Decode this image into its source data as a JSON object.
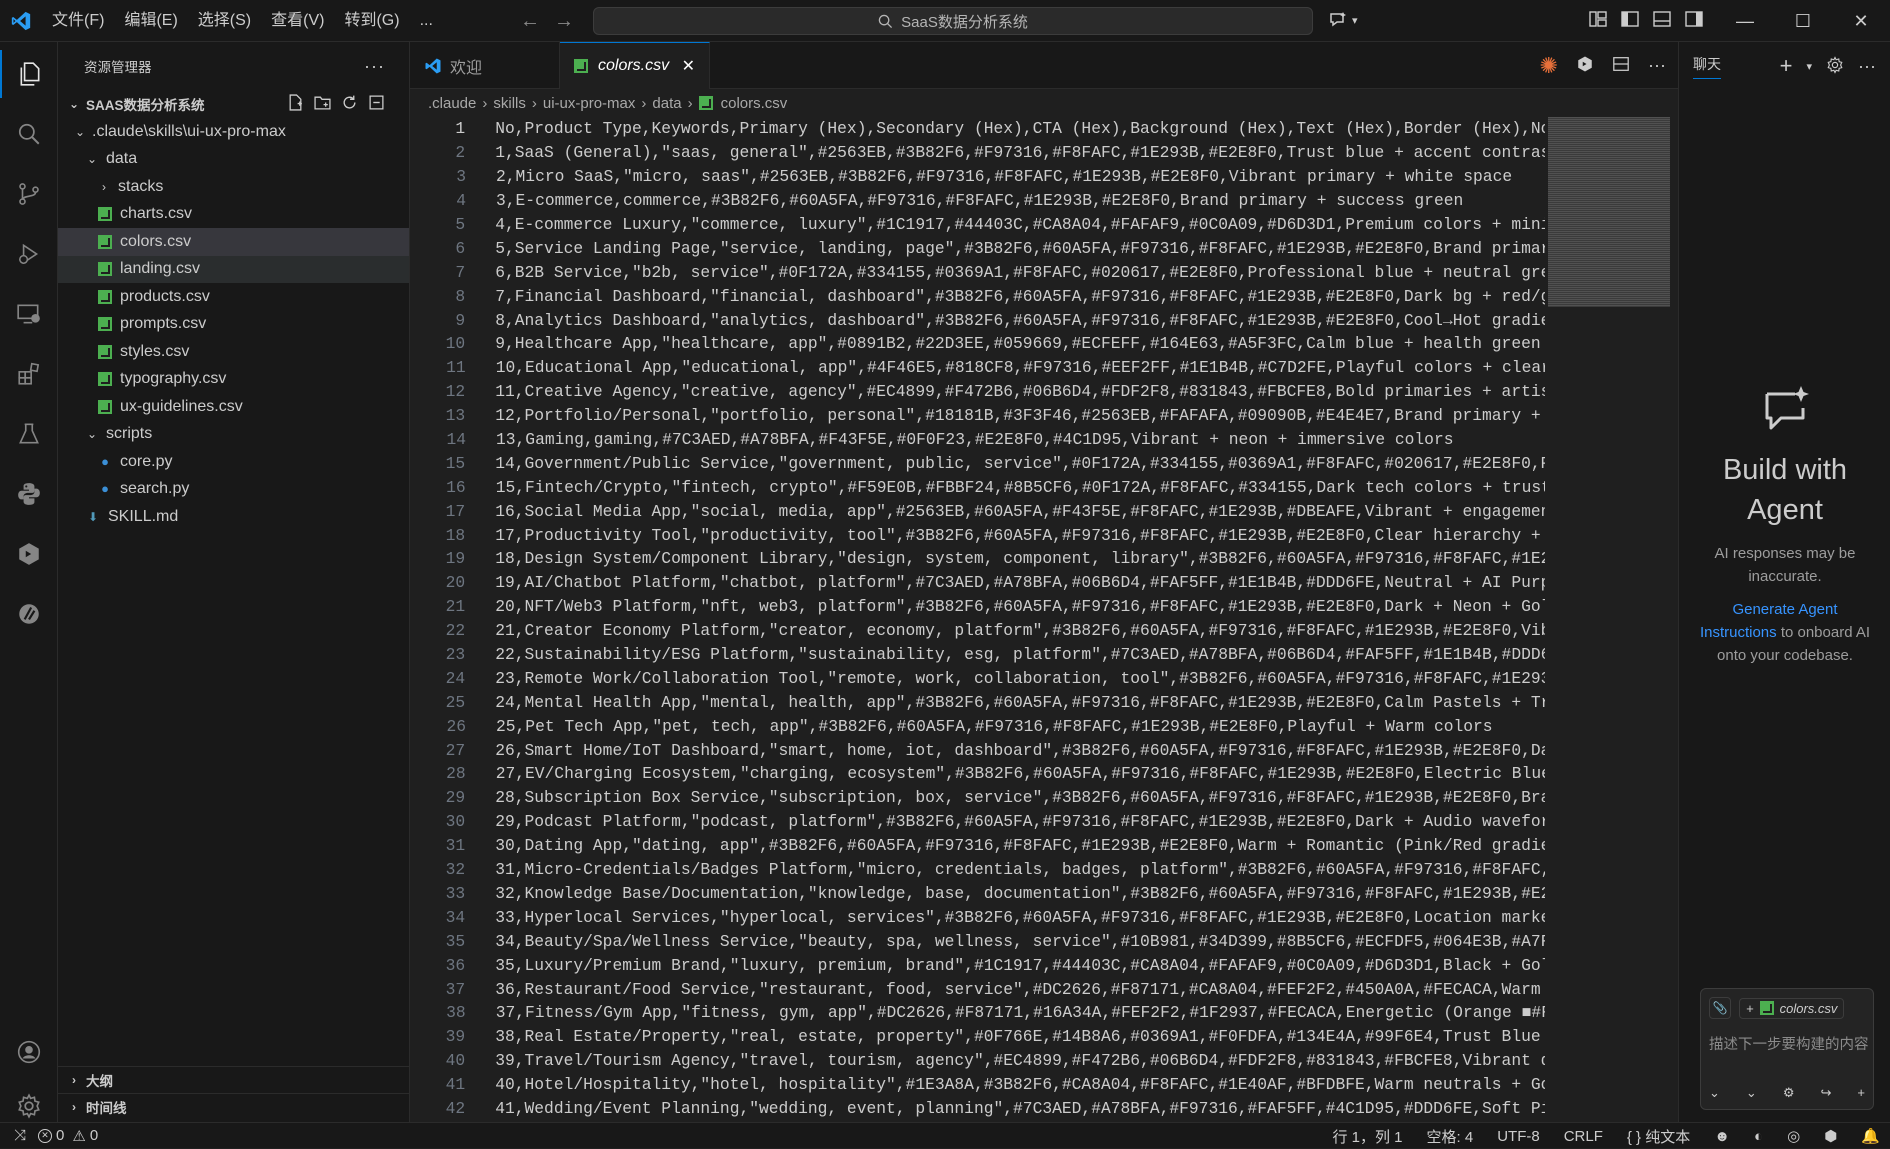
{
  "titlebar": {
    "menu": [
      "文件(F)",
      "编辑(E)",
      "选择(S)",
      "查看(V)",
      "转到(G)",
      "..."
    ],
    "search_text": "SaaS数据分析系统",
    "colors": {
      "accent": "#0078d4",
      "bg": "#181818",
      "editor_bg": "#1f1f1f"
    }
  },
  "activity_bar": {
    "items": [
      "explorer-icon",
      "search-icon",
      "source-control-icon",
      "run-debug-icon",
      "remote-explorer-icon",
      "extensions-icon",
      "testing-icon",
      "python-icon",
      "deploy-icon",
      "kiro-icon"
    ],
    "bottom": [
      "account-icon",
      "settings-gear-icon"
    ]
  },
  "sidebar": {
    "title": "资源管理器",
    "section": "SAAS数据分析系统",
    "tree": [
      {
        "label": ".claude\\skills\\ui-ux-pro-max",
        "type": "folder",
        "open": true,
        "indent": 1
      },
      {
        "label": "data",
        "type": "folder",
        "open": true,
        "indent": 2
      },
      {
        "label": "stacks",
        "type": "folder",
        "open": false,
        "indent": 3
      },
      {
        "label": "charts.csv",
        "type": "csv",
        "indent": 3
      },
      {
        "label": "colors.csv",
        "type": "csv",
        "indent": 3,
        "selected": true
      },
      {
        "label": "landing.csv",
        "type": "csv",
        "indent": 3,
        "hover": true
      },
      {
        "label": "products.csv",
        "type": "csv",
        "indent": 3
      },
      {
        "label": "prompts.csv",
        "type": "csv",
        "indent": 3
      },
      {
        "label": "styles.csv",
        "type": "csv",
        "indent": 3
      },
      {
        "label": "typography.csv",
        "type": "csv",
        "indent": 3
      },
      {
        "label": "ux-guidelines.csv",
        "type": "csv",
        "indent": 3
      },
      {
        "label": "scripts",
        "type": "folder",
        "open": true,
        "indent": 2
      },
      {
        "label": "core.py",
        "type": "py",
        "indent": 3
      },
      {
        "label": "search.py",
        "type": "py",
        "indent": 3
      },
      {
        "label": "SKILL.md",
        "type": "md",
        "indent": 2
      }
    ],
    "outline": "大纲",
    "timeline": "时间线"
  },
  "tabs": [
    {
      "label": "欢迎",
      "active": false
    },
    {
      "label": "colors.csv",
      "active": true
    }
  ],
  "breadcrumb": [
    ".claude",
    "skills",
    "ui-ux-pro-max",
    "data",
    "colors.csv"
  ],
  "editor": {
    "cursor_line": 1,
    "lines": [
      "No,Product Type,Keywords,Primary (Hex),Secondary (Hex),CTA (Hex),Background (Hex),Text (Hex),Border (Hex),Not",
      "1,SaaS (General),\"saas, general\",#2563EB,#3B82F6,#F97316,#F8FAFC,#1E293B,#E2E8F0,Trust blue + accent contrast",
      "2,Micro SaaS,\"micro, saas\",#2563EB,#3B82F6,#F97316,#F8FAFC,#1E293B,#E2E8F0,Vibrant primary + white space",
      "3,E-commerce,commerce,#3B82F6,#60A5FA,#F97316,#F8FAFC,#1E293B,#E2E8F0,Brand primary + success green",
      "4,E-commerce Luxury,\"commerce, luxury\",#1C1917,#44403C,#CA8A04,#FAFAF9,#0C0A09,#D6D3D1,Premium colors + minim",
      "5,Service Landing Page,\"service, landing, page\",#3B82F6,#60A5FA,#F97316,#F8FAFC,#1E293B,#E2E8F0,Brand primary",
      "6,B2B Service,\"b2b, service\",#0F172A,#334155,#0369A1,#F8FAFC,#020617,#E2E8F0,Professional blue + neutral grey",
      "7,Financial Dashboard,\"financial, dashboard\",#3B82F6,#60A5FA,#F97316,#F8FAFC,#1E293B,#E2E8F0,Dark bg + red/gr",
      "8,Analytics Dashboard,\"analytics, dashboard\",#3B82F6,#60A5FA,#F97316,#F8FAFC,#1E293B,#E2E8F0,Cool→Hot gradien",
      "9,Healthcare App,\"healthcare, app\",#0891B2,#22D3EE,#059669,#ECFEFF,#164E63,#A5F3FC,Calm blue + health green +",
      "10,Educational App,\"educational, app\",#4F46E5,#818CF8,#F97316,#EEF2FF,#1E1B4B,#C7D2FE,Playful colors + clear",
      "11,Creative Agency,\"creative, agency\",#EC4899,#F472B6,#06B6D4,#FDF2F8,#831843,#FBCFE8,Bold primaries + artist",
      "12,Portfolio/Personal,\"portfolio, personal\",#18181B,#3F3F46,#2563EB,#FAFAFA,#09090B,#E4E4E7,Brand primary + a",
      "13,Gaming,gaming,#7C3AED,#A78BFA,#F43F5E,#0F0F23,#E2E8F0,#4C1D95,Vibrant + neon + immersive colors",
      "14,Government/Public Service,\"government, public, service\",#0F172A,#334155,#0369A1,#F8FAFC,#020617,#E2E8F0,Pr",
      "15,Fintech/Crypto,\"fintech, crypto\",#F59E0B,#FBBF24,#8B5CF6,#0F172A,#F8FAFC,#334155,Dark tech colors + trust",
      "16,Social Media App,\"social, media, app\",#2563EB,#60A5FA,#F43F5E,#F8FAFC,#1E293B,#DBEAFE,Vibrant + engagement",
      "17,Productivity Tool,\"productivity, tool\",#3B82F6,#60A5FA,#F97316,#F8FAFC,#1E293B,#E2E8F0,Clear hierarchy + f",
      "18,Design System/Component Library,\"design, system, component, library\",#3B82F6,#60A5FA,#F97316,#F8FAFC,#1E29",
      "19,AI/Chatbot Platform,\"chatbot, platform\",#7C3AED,#A78BFA,#06B6D4,#FAF5FF,#1E1B4B,#DDD6FE,Neutral + AI Purpl",
      "20,NFT/Web3 Platform,\"nft, web3, platform\",#3B82F6,#60A5FA,#F97316,#F8FAFC,#1E293B,#E2E8F0,Dark + Neon + Gold",
      "21,Creator Economy Platform,\"creator, economy, platform\",#3B82F6,#60A5FA,#F97316,#F8FAFC,#1E293B,#E2E8F0,Vibr",
      "22,Sustainability/ESG Platform,\"sustainability, esg, platform\",#7C3AED,#A78BFA,#06B6D4,#FAF5FF,#1E1B4B,#DDD6F",
      "23,Remote Work/Collaboration Tool,\"remote, work, collaboration, tool\",#3B82F6,#60A5FA,#F97316,#F8FAFC,#1E293E",
      "24,Mental Health App,\"mental, health, app\",#3B82F6,#60A5FA,#F97316,#F8FAFC,#1E293B,#E2E8F0,Calm Pastels + Tru",
      "25,Pet Tech App,\"pet, tech, app\",#3B82F6,#60A5FA,#F97316,#F8FAFC,#1E293B,#E2E8F0,Playful + Warm colors",
      "26,Smart Home/IoT Dashboard,\"smart, home, iot, dashboard\",#3B82F6,#60A5FA,#F97316,#F8FAFC,#1E293B,#E2E8F0,Dar",
      "27,EV/Charging Ecosystem,\"charging, ecosystem\",#3B82F6,#60A5FA,#F97316,#F8FAFC,#1E293B,#E2E8F0,Electric Blue",
      "28,Subscription Box Service,\"subscription, box, service\",#3B82F6,#60A5FA,#F97316,#F8FAFC,#1E293B,#E2E8F0,Bran",
      "29,Podcast Platform,\"podcast, platform\",#3B82F6,#60A5FA,#F97316,#F8FAFC,#1E293B,#E2E8F0,Dark + Audio waveform",
      "30,Dating App,\"dating, app\",#3B82F6,#60A5FA,#F97316,#F8FAFC,#1E293B,#E2E8F0,Warm + Romantic (Pink/Red gradien",
      "31,Micro-Credentials/Badges Platform,\"micro, credentials, badges, platform\",#3B82F6,#60A5FA,#F97316,#F8FAFC,#",
      "32,Knowledge Base/Documentation,\"knowledge, base, documentation\",#3B82F6,#60A5FA,#F97316,#F8FAFC,#1E293B,#E2E",
      "33,Hyperlocal Services,\"hyperlocal, services\",#3B82F6,#60A5FA,#F97316,#F8FAFC,#1E293B,#E2E8F0,Location marker",
      "34,Beauty/Spa/Wellness Service,\"beauty, spa, wellness, service\",#10B981,#34D399,#8B5CF6,#ECFDF5,#064E3B,#A7F3",
      "35,Luxury/Premium Brand,\"luxury, premium, brand\",#1C1917,#44403C,#CA8A04,#FAFAF9,#0C0A09,#D6D3D1,Black + Gold",
      "36,Restaurant/Food Service,\"restaurant, food, service\",#DC2626,#F87171,#CA8A04,#FEF2F2,#450A0A,#FECACA,Warm c",
      "37,Fitness/Gym App,\"fitness, gym, app\",#DC2626,#F87171,#16A34A,#FEF2F2,#1F2937,#FECACA,Energetic (Orange ■#F",
      "38,Real Estate/Property,\"real, estate, property\",#0F766E,#14B8A6,#0369A1,#F0FDFA,#134E4A,#99F6E4,Trust Blue (",
      "39,Travel/Tourism Agency,\"travel, tourism, agency\",#EC4899,#F472B6,#06B6D4,#FDF2F8,#831843,#FBCFE8,Vibrant de",
      "40,Hotel/Hospitality,\"hotel, hospitality\",#1E3A8A,#3B82F6,#CA8A04,#F8FAFC,#1E40AF,#BFDBFE,Warm neutrals + Gol",
      "41,Wedding/Event Planning,\"wedding, event, planning\",#7C3AED,#A78BFA,#F97316,#FAF5FF,#4C1D95,#DDD6FE,Soft Pir"
    ]
  },
  "chat": {
    "tab": "聊天",
    "headline": "Build with Agent",
    "note": "AI responses may be inaccurate.",
    "link": "Generate Agent Instructions",
    "link_suffix": "to onboard AI onto your codebase.",
    "context_file": "colors.csv",
    "input_placeholder": "描述下一步要构建的内容"
  },
  "statusbar": {
    "errors": "0",
    "warnings": "0",
    "position": "行 1，列 1",
    "spaces": "空格: 4",
    "encoding": "UTF-8",
    "eol": "CRLF",
    "language": "纯文本"
  }
}
